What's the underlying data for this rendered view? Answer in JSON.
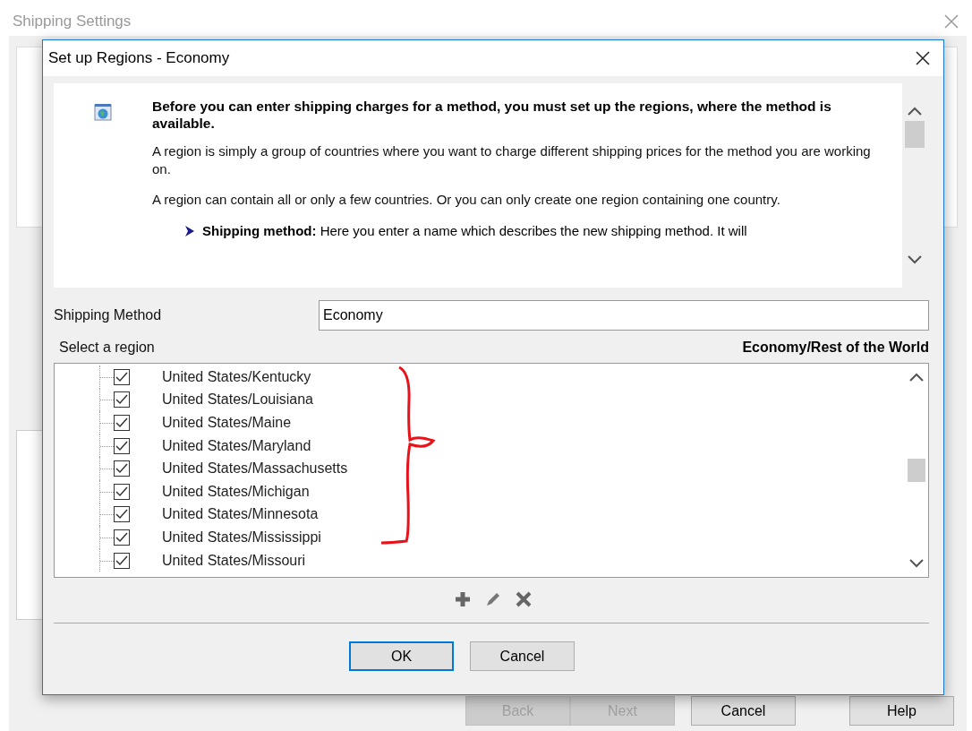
{
  "background_window": {
    "title": "Shipping Settings",
    "buttons": [
      {
        "label": "Back",
        "disabled": true
      },
      {
        "label": "Next",
        "disabled": true
      },
      {
        "label": "Cancel",
        "disabled": false
      },
      {
        "label": "Help",
        "disabled": false
      }
    ]
  },
  "dialog": {
    "title": "Set up Regions - Economy",
    "help": {
      "heading": "Before you can enter shipping charges for a method, you must set up the regions, where the method is available.",
      "paragraphs": [
        "A region is simply a group of countries where you want to charge different shipping prices for the method you are working on.",
        "A region can contain all or only a few countries. Or you can only create one region containing one country."
      ],
      "bullets": [
        "**Shipping method:** Here you enter a name which describes the new shipping method. It will"
      ]
    },
    "shipping_method": {
      "label": "Shipping Method",
      "value": "Economy"
    },
    "region_label": "Select a region",
    "selected_region": "Economy/Rest of the World",
    "regions": [
      {
        "name": "United States/Kentucky",
        "checked": true
      },
      {
        "name": "United States/Louisiana",
        "checked": true
      },
      {
        "name": "United States/Maine",
        "checked": true
      },
      {
        "name": "United States/Maryland",
        "checked": true
      },
      {
        "name": "United States/Massachusetts",
        "checked": true
      },
      {
        "name": "United States/Michigan",
        "checked": true
      },
      {
        "name": "United States/Minnesota",
        "checked": true
      },
      {
        "name": "United States/Mississippi",
        "checked": true
      },
      {
        "name": "United States/Missouri",
        "checked": true
      }
    ],
    "buttons": [
      {
        "label": "OK",
        "default": true
      },
      {
        "label": "Cancel",
        "default": false
      }
    ]
  }
}
